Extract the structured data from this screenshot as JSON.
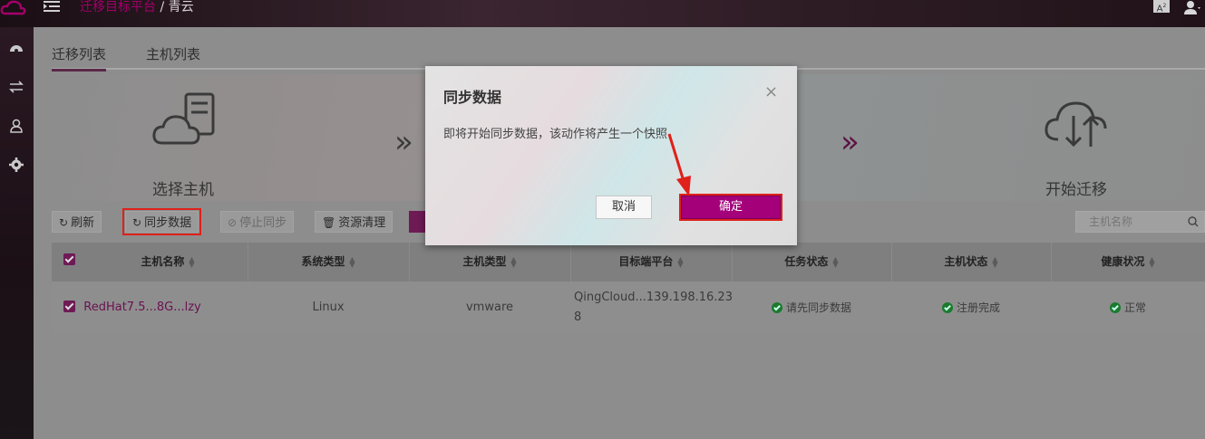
{
  "header": {
    "platform": "迁移目标平台",
    "separator": "/",
    "target": "青云",
    "lang_label": "A"
  },
  "tabs": [
    {
      "label": "迁移列表",
      "active": true
    },
    {
      "label": "主机列表",
      "active": false
    }
  ],
  "wizard": {
    "step1_label": "选择主机",
    "step_last_label": "开始迁移"
  },
  "toolbar": {
    "refresh": "刷新",
    "sync": "同步数据",
    "stop_sync": "停止同步",
    "cleanup": "资源清理",
    "search_placeholder": "主机名称"
  },
  "table": {
    "headers": [
      "主机名称",
      "系统类型",
      "主机类型",
      "目标端平台",
      "任务状态",
      "主机状态",
      "健康状况"
    ],
    "row": {
      "name": "RedHat7.5...8G...lzy",
      "os": "Linux",
      "host_type": "vmware",
      "target_line1": "QingCloud...139.198.16.23",
      "target_line2": "8",
      "task_status": "请先同步数据",
      "host_status": "注册完成",
      "health": "正常"
    }
  },
  "modal": {
    "title": "同步数据",
    "close": "×",
    "message": "即将开始同步数据，该动作将产生一个快照",
    "cancel": "取消",
    "confirm": "确定"
  },
  "colors": {
    "accent": "#a3007a",
    "highlight": "#e0201a",
    "success": "#1b7a2e"
  }
}
